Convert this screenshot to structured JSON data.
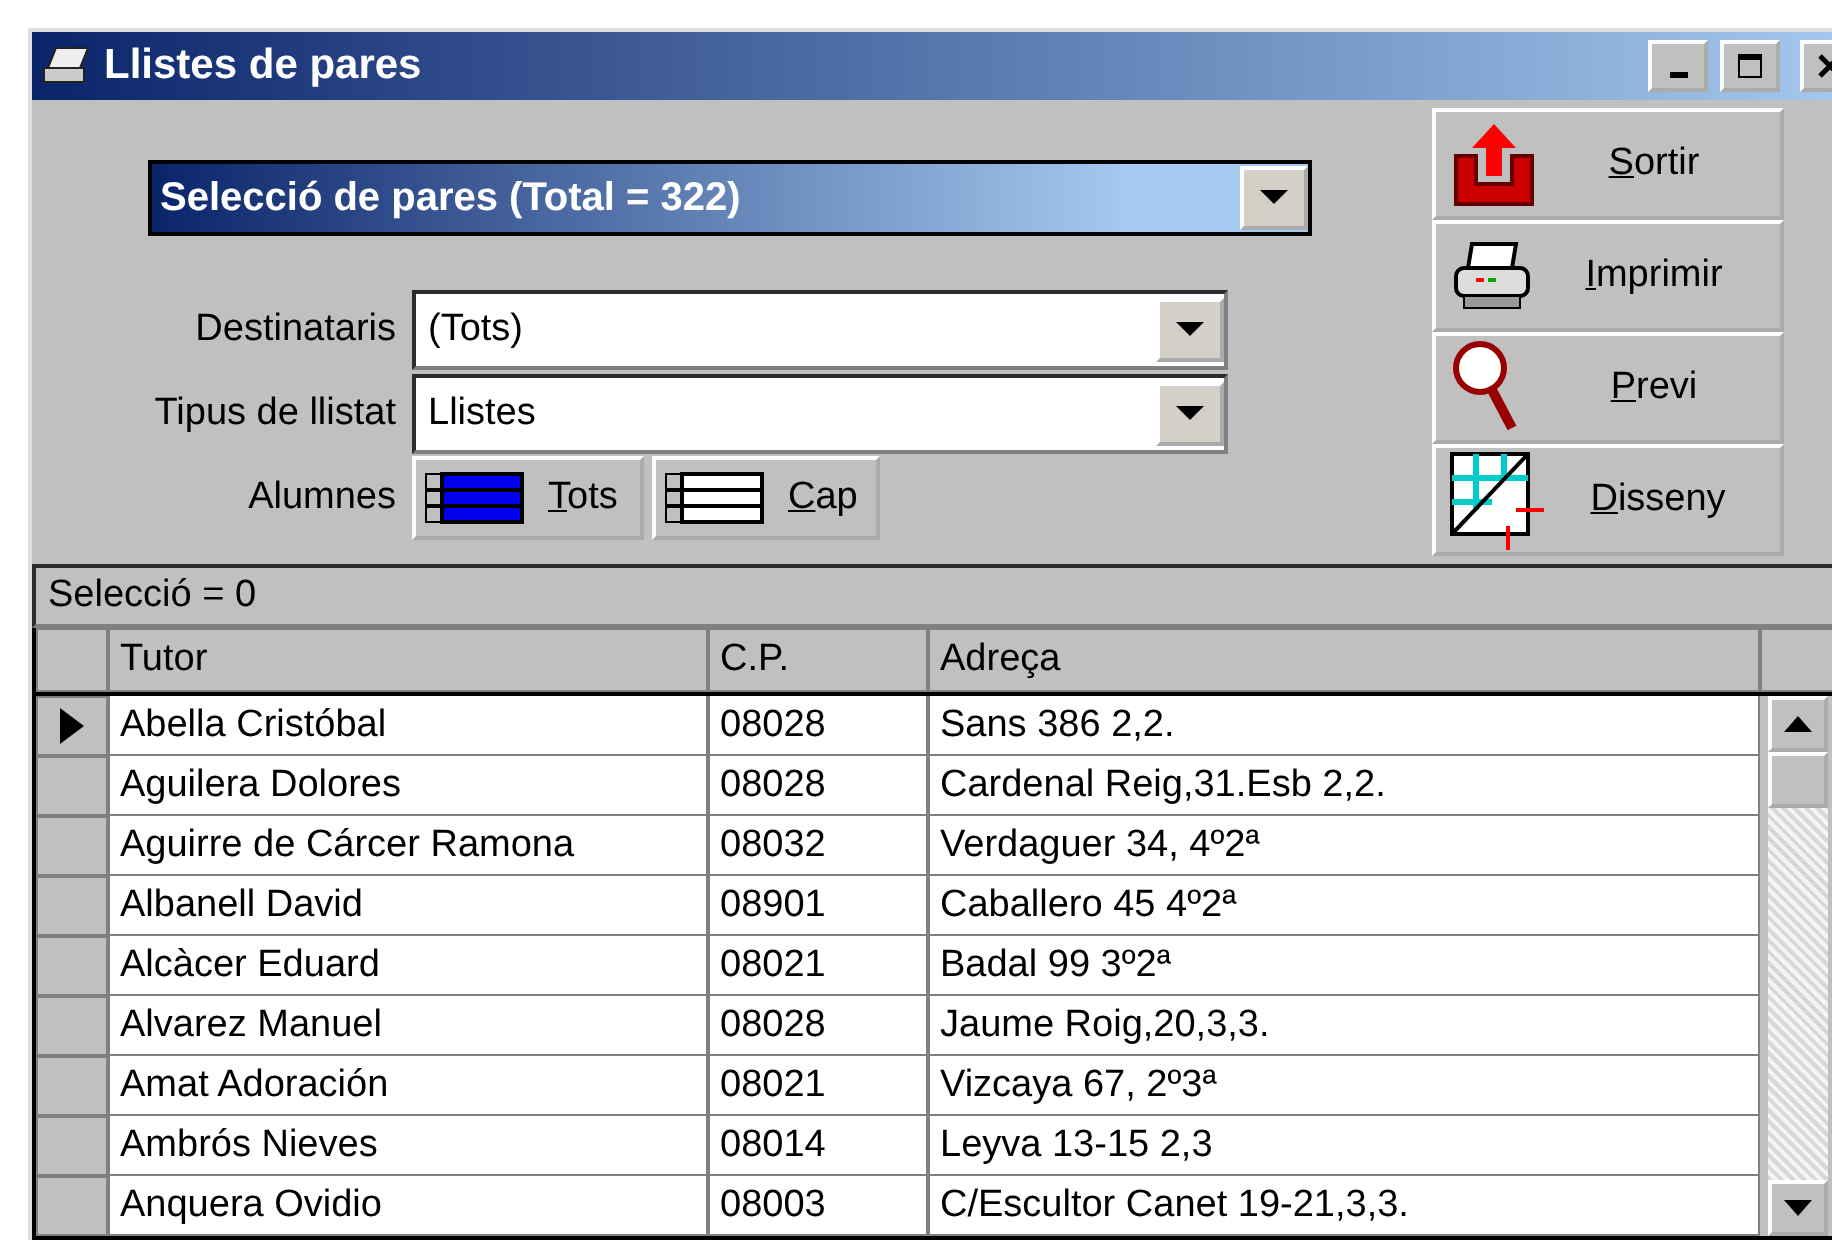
{
  "window": {
    "title": "Llistes de pares"
  },
  "selection_header": {
    "label": "Selecció de pares  (Total = 322)"
  },
  "fields": [
    {
      "label": "Destinataris",
      "value": "(Tots)"
    },
    {
      "label": "Tipus de llistat",
      "value": "Llistes"
    }
  ],
  "students": {
    "label": "Alumnes",
    "buttons": [
      {
        "kind": "all",
        "key": "T",
        "rest": "ots"
      },
      {
        "kind": "none",
        "key": "C",
        "rest": "ap"
      }
    ]
  },
  "actions": [
    {
      "kind": "exit",
      "key": "S",
      "rest": "ortir"
    },
    {
      "kind": "print",
      "key": "I",
      "rest": "mprimir"
    },
    {
      "kind": "preview",
      "key": "P",
      "rest": "revi"
    },
    {
      "kind": "design",
      "key": "D",
      "rest": "isseny"
    }
  ],
  "status": "Selecció = 0",
  "table": {
    "columns": [
      "Tutor",
      "C.P.",
      "Adreça"
    ],
    "rows": [
      {
        "cells": [
          "Abella Cristóbal",
          "08028",
          "Sans 386 2,2."
        ],
        "selected": true
      },
      {
        "cells": [
          "Aguilera Dolores",
          "08028",
          "Cardenal Reig,31.Esb 2,2."
        ],
        "selected": false
      },
      {
        "cells": [
          "Aguirre de Cárcer Ramona",
          "08032",
          "Verdaguer 34, 4º2ª"
        ],
        "selected": false
      },
      {
        "cells": [
          "Albanell David",
          "08901",
          "Caballero 45 4º2ª"
        ],
        "selected": false
      },
      {
        "cells": [
          "Alcàcer Eduard",
          "08021",
          "Badal 99 3º2ª"
        ],
        "selected": false
      },
      {
        "cells": [
          "Alvarez Manuel",
          "08028",
          "Jaume Roig,20,3,3."
        ],
        "selected": false
      },
      {
        "cells": [
          "Amat Adoración",
          "08021",
          "Vizcaya 67, 2º3ª"
        ],
        "selected": false
      },
      {
        "cells": [
          "Ambrós Nieves",
          "08014",
          "Leyva 13-15 2,3"
        ],
        "selected": false
      },
      {
        "cells": [
          "Anquera Ovidio",
          "08003",
          "C/Escultor Canet 19-21,3,3."
        ],
        "selected": false
      }
    ]
  }
}
